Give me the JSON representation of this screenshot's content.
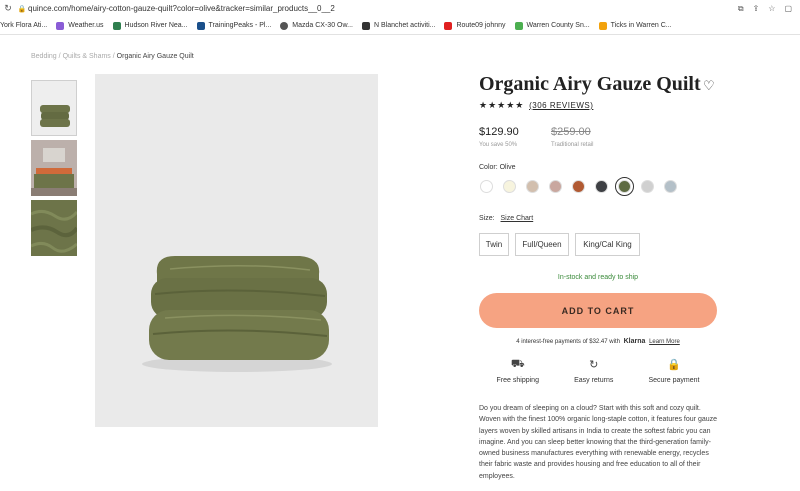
{
  "browser": {
    "url": "quince.com/home/airy-cotton-gauze-quilt?color=olive&tracker=similar_products__0__2",
    "bookmarks": [
      {
        "label": "York Flora Ati...",
        "icon": "york-flora-icon",
        "color": "#ffffff"
      },
      {
        "label": "Weather.us",
        "icon": "weather-icon",
        "color": "#8a5cd6"
      },
      {
        "label": "Hudson River Nea...",
        "icon": "hudson-river-icon",
        "color": "#2f7f4f"
      },
      {
        "label": "TrainingPeaks - Pl...",
        "icon": "trainingpeaks-icon",
        "color": "#1a4f8a"
      },
      {
        "label": "Mazda CX-30 Ow...",
        "icon": "mazda-icon",
        "color": "#555555"
      },
      {
        "label": "N Blanchet activiti...",
        "icon": "blanchet-icon",
        "color": "#333333"
      },
      {
        "label": "Route09 johnny",
        "icon": "youtube-icon",
        "color": "#e02020"
      },
      {
        "label": "Warren County Sn...",
        "icon": "warren-county-icon",
        "color": "#4caf50"
      },
      {
        "label": "Ticks in Warren C...",
        "icon": "ticks-icon",
        "color": "#f2a20c"
      }
    ]
  },
  "breadcrumb": {
    "items": [
      "Bedding",
      "Quilts & Shams"
    ],
    "separator": "/",
    "current": "Organic Airy Gauze Quilt"
  },
  "product": {
    "title": "Organic Airy Gauze Quilt",
    "stars": "★★★★★",
    "reviews": "(306 REVIEWS)",
    "price": "$129.90",
    "save_text": "You save 50%",
    "old_price": "$259.00",
    "traditional_label": "Traditional retail",
    "color_label": "Color: Olive",
    "swatches": [
      "#ffffff",
      "#f7f4de",
      "#d2bfae",
      "#c9a79f",
      "#b15a33",
      "#3e4044",
      "#5e6b42",
      "#d0d0d0",
      "#b4c0c8"
    ],
    "selected_swatch": 6,
    "size_label": "Size:",
    "size_chart": "Size Chart",
    "sizes": [
      "Twin",
      "Full/Queen",
      "King/Cal King"
    ],
    "stock": "In-stock and ready to ship",
    "add_to_cart": "ADD TO CART",
    "klarna": {
      "prefix": "4 interest-free payments of $32.47 with",
      "brand": "Klarna",
      "link": "Learn More"
    },
    "perks": [
      {
        "label": "Free shipping",
        "icon": "truck-icon"
      },
      {
        "label": "Easy returns",
        "icon": "returns-icon"
      },
      {
        "label": "Secure payment",
        "icon": "lock-icon"
      }
    ],
    "description": "Do you dream of sleeping on a cloud? Start with this soft and cozy quilt. Woven with the finest 100% organic long-staple cotton, it features four gauze layers woven by skilled artisans in India to create the softest fabric you can imagine. And you can sleep better knowing that the third-generation family-owned business manufactures everything with renewable energy, recycles their fabric waste and provides housing and free education to all of their employees."
  },
  "colors": {
    "accent_button": "#f6a382",
    "in_stock": "#3a8a3a",
    "olive": "#6d7449"
  }
}
